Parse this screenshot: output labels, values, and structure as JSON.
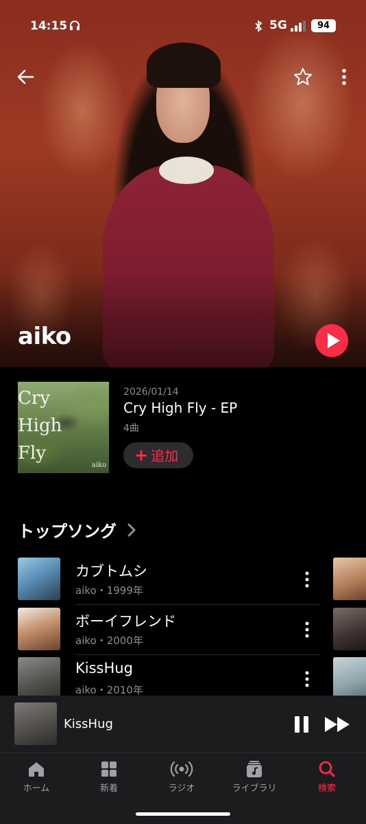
{
  "status_bar": {
    "time": "14:15",
    "network": "5G",
    "battery": "94"
  },
  "artist": {
    "name": "aiko"
  },
  "latest_release": {
    "date": "2026/01/14",
    "title": "Cry High Fly - EP",
    "track_count": "4曲",
    "add_label": "追加",
    "art_text_lines": [
      "Cry",
      "High",
      "Fly"
    ],
    "art_sub": "aiko"
  },
  "top_songs": {
    "title": "トップソング",
    "items": [
      {
        "title": "カブトムシ",
        "subtitle": "aiko・1999年"
      },
      {
        "title": "ボーイフレンド",
        "subtitle": "aiko・2000年"
      },
      {
        "title": "KissHug",
        "subtitle": "aiko・2010年"
      }
    ]
  },
  "now_playing": {
    "title": "KissHug"
  },
  "tabs": [
    {
      "label": "ホーム",
      "icon": "house-icon"
    },
    {
      "label": "新着",
      "icon": "grid-icon"
    },
    {
      "label": "ラジオ",
      "icon": "radio-icon"
    },
    {
      "label": "ライブラリ",
      "icon": "library-icon"
    },
    {
      "label": "検索",
      "icon": "search-icon",
      "active": true
    }
  ],
  "colors": {
    "accent": "#fa2d48",
    "background": "#000000",
    "secondary_text": "#8e8e93"
  }
}
